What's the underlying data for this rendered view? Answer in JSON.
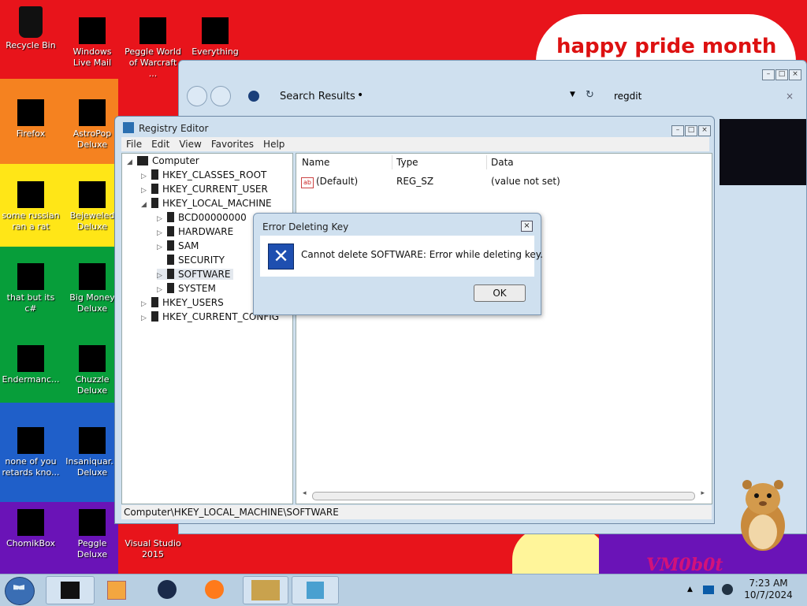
{
  "desktop": {
    "banner_text": "happy pride month",
    "watermark": "VM0b0t",
    "icons": [
      {
        "label": "Recycle Bin",
        "icon": "recycle-bin-icon"
      },
      {
        "label": "Windows Live Mail",
        "icon": "mail-icon"
      },
      {
        "label": "Peggle World of Warcraft ...",
        "icon": "peggle-icon"
      },
      {
        "label": "Everything",
        "icon": "search-app-icon"
      },
      {
        "label": "Firefox",
        "icon": "firefox-icon"
      },
      {
        "label": "AstroPop Deluxe",
        "icon": "game-icon"
      },
      {
        "label": "some russian ran a rat",
        "icon": "app-icon"
      },
      {
        "label": "Bejeweled Deluxe",
        "icon": "gem-icon"
      },
      {
        "label": "that but its c#",
        "icon": "app-icon"
      },
      {
        "label": "Big Money Deluxe",
        "icon": "money-icon"
      },
      {
        "label": "Endermanc...",
        "icon": "app-icon"
      },
      {
        "label": "Chuzzle Deluxe",
        "icon": "game-icon"
      },
      {
        "label": "none of you retards kno...",
        "icon": "app-icon"
      },
      {
        "label": "Insaniquar... Deluxe",
        "icon": "game-icon"
      },
      {
        "label": "ChomikBox",
        "icon": "box-icon"
      },
      {
        "label": "Peggle Deluxe",
        "icon": "peggle-icon"
      },
      {
        "label": "Visual Studio 2015",
        "icon": "visual-studio-icon"
      }
    ]
  },
  "search_window": {
    "breadcrumb": "Search Results",
    "search_query": "regdit"
  },
  "regedit": {
    "title": "Registry Editor",
    "menu": [
      "File",
      "Edit",
      "View",
      "Favorites",
      "Help"
    ],
    "tree": {
      "root": "Computer",
      "hives": [
        "HKEY_CLASSES_ROOT",
        "HKEY_CURRENT_USER",
        "HKEY_LOCAL_MACHINE",
        "HKEY_USERS",
        "HKEY_CURRENT_CONFIG"
      ],
      "hklm_children": [
        "BCD00000000",
        "HARDWARE",
        "SAM",
        "SECURITY",
        "SOFTWARE",
        "SYSTEM"
      ]
    },
    "columns": {
      "name": "Name",
      "type": "Type",
      "data": "Data"
    },
    "values": [
      {
        "name": "(Default)",
        "type": "REG_SZ",
        "data": "(value not set)"
      }
    ],
    "status_path": "Computer\\HKEY_LOCAL_MACHINE\\SOFTWARE"
  },
  "error_dialog": {
    "title": "Error Deleting Key",
    "message": "Cannot delete SOFTWARE:  Error while deleting key.",
    "ok_label": "OK"
  },
  "taskbar": {
    "time": "7:23 AM",
    "date": "10/7/2024"
  },
  "colors": {
    "red": "#e8141b",
    "orange": "#f58220",
    "yellow": "#ffe617",
    "green": "#079e3a",
    "blue": "#1f5fc9",
    "purple": "#6a13b7"
  }
}
